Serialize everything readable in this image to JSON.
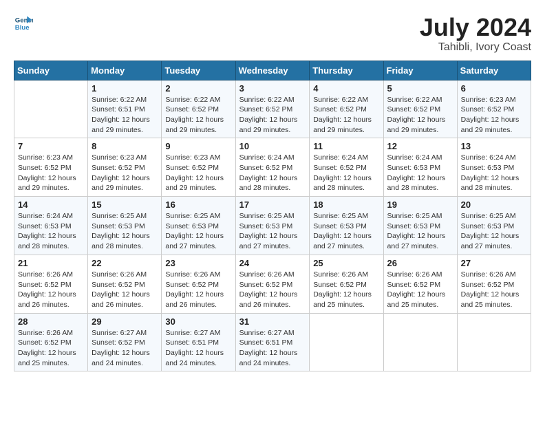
{
  "header": {
    "logo_line1": "General",
    "logo_line2": "Blue",
    "month_year": "July 2024",
    "location": "Tahibli, Ivory Coast"
  },
  "weekdays": [
    "Sunday",
    "Monday",
    "Tuesday",
    "Wednesday",
    "Thursday",
    "Friday",
    "Saturday"
  ],
  "weeks": [
    [
      {
        "num": "",
        "info": ""
      },
      {
        "num": "1",
        "info": "Sunrise: 6:22 AM\nSunset: 6:51 PM\nDaylight: 12 hours\nand 29 minutes."
      },
      {
        "num": "2",
        "info": "Sunrise: 6:22 AM\nSunset: 6:52 PM\nDaylight: 12 hours\nand 29 minutes."
      },
      {
        "num": "3",
        "info": "Sunrise: 6:22 AM\nSunset: 6:52 PM\nDaylight: 12 hours\nand 29 minutes."
      },
      {
        "num": "4",
        "info": "Sunrise: 6:22 AM\nSunset: 6:52 PM\nDaylight: 12 hours\nand 29 minutes."
      },
      {
        "num": "5",
        "info": "Sunrise: 6:22 AM\nSunset: 6:52 PM\nDaylight: 12 hours\nand 29 minutes."
      },
      {
        "num": "6",
        "info": "Sunrise: 6:23 AM\nSunset: 6:52 PM\nDaylight: 12 hours\nand 29 minutes."
      }
    ],
    [
      {
        "num": "7",
        "info": "Sunrise: 6:23 AM\nSunset: 6:52 PM\nDaylight: 12 hours\nand 29 minutes."
      },
      {
        "num": "8",
        "info": "Sunrise: 6:23 AM\nSunset: 6:52 PM\nDaylight: 12 hours\nand 29 minutes."
      },
      {
        "num": "9",
        "info": "Sunrise: 6:23 AM\nSunset: 6:52 PM\nDaylight: 12 hours\nand 29 minutes."
      },
      {
        "num": "10",
        "info": "Sunrise: 6:24 AM\nSunset: 6:52 PM\nDaylight: 12 hours\nand 28 minutes."
      },
      {
        "num": "11",
        "info": "Sunrise: 6:24 AM\nSunset: 6:52 PM\nDaylight: 12 hours\nand 28 minutes."
      },
      {
        "num": "12",
        "info": "Sunrise: 6:24 AM\nSunset: 6:53 PM\nDaylight: 12 hours\nand 28 minutes."
      },
      {
        "num": "13",
        "info": "Sunrise: 6:24 AM\nSunset: 6:53 PM\nDaylight: 12 hours\nand 28 minutes."
      }
    ],
    [
      {
        "num": "14",
        "info": "Sunrise: 6:24 AM\nSunset: 6:53 PM\nDaylight: 12 hours\nand 28 minutes."
      },
      {
        "num": "15",
        "info": "Sunrise: 6:25 AM\nSunset: 6:53 PM\nDaylight: 12 hours\nand 28 minutes."
      },
      {
        "num": "16",
        "info": "Sunrise: 6:25 AM\nSunset: 6:53 PM\nDaylight: 12 hours\nand 27 minutes."
      },
      {
        "num": "17",
        "info": "Sunrise: 6:25 AM\nSunset: 6:53 PM\nDaylight: 12 hours\nand 27 minutes."
      },
      {
        "num": "18",
        "info": "Sunrise: 6:25 AM\nSunset: 6:53 PM\nDaylight: 12 hours\nand 27 minutes."
      },
      {
        "num": "19",
        "info": "Sunrise: 6:25 AM\nSunset: 6:53 PM\nDaylight: 12 hours\nand 27 minutes."
      },
      {
        "num": "20",
        "info": "Sunrise: 6:25 AM\nSunset: 6:53 PM\nDaylight: 12 hours\nand 27 minutes."
      }
    ],
    [
      {
        "num": "21",
        "info": "Sunrise: 6:26 AM\nSunset: 6:52 PM\nDaylight: 12 hours\nand 26 minutes."
      },
      {
        "num": "22",
        "info": "Sunrise: 6:26 AM\nSunset: 6:52 PM\nDaylight: 12 hours\nand 26 minutes."
      },
      {
        "num": "23",
        "info": "Sunrise: 6:26 AM\nSunset: 6:52 PM\nDaylight: 12 hours\nand 26 minutes."
      },
      {
        "num": "24",
        "info": "Sunrise: 6:26 AM\nSunset: 6:52 PM\nDaylight: 12 hours\nand 26 minutes."
      },
      {
        "num": "25",
        "info": "Sunrise: 6:26 AM\nSunset: 6:52 PM\nDaylight: 12 hours\nand 25 minutes."
      },
      {
        "num": "26",
        "info": "Sunrise: 6:26 AM\nSunset: 6:52 PM\nDaylight: 12 hours\nand 25 minutes."
      },
      {
        "num": "27",
        "info": "Sunrise: 6:26 AM\nSunset: 6:52 PM\nDaylight: 12 hours\nand 25 minutes."
      }
    ],
    [
      {
        "num": "28",
        "info": "Sunrise: 6:26 AM\nSunset: 6:52 PM\nDaylight: 12 hours\nand 25 minutes."
      },
      {
        "num": "29",
        "info": "Sunrise: 6:27 AM\nSunset: 6:52 PM\nDaylight: 12 hours\nand 24 minutes."
      },
      {
        "num": "30",
        "info": "Sunrise: 6:27 AM\nSunset: 6:51 PM\nDaylight: 12 hours\nand 24 minutes."
      },
      {
        "num": "31",
        "info": "Sunrise: 6:27 AM\nSunset: 6:51 PM\nDaylight: 12 hours\nand 24 minutes."
      },
      {
        "num": "",
        "info": ""
      },
      {
        "num": "",
        "info": ""
      },
      {
        "num": "",
        "info": ""
      }
    ]
  ]
}
